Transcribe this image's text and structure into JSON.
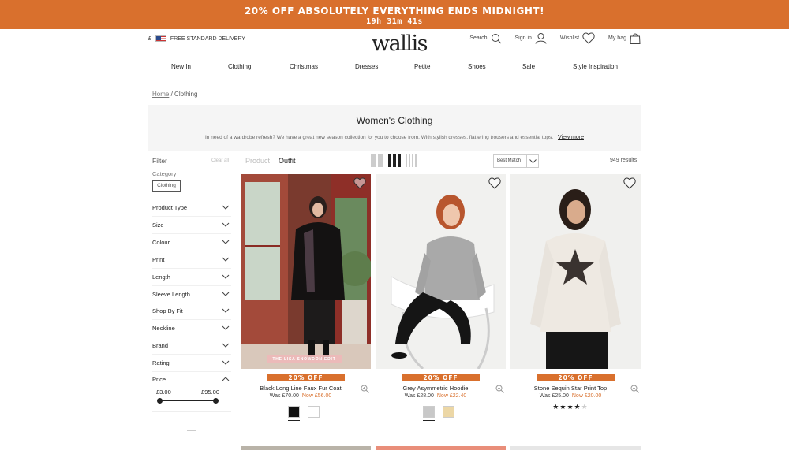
{
  "promo": {
    "headline": "20% OFF ABSOLUTELY EVERYTHING ENDS MIDNIGHT!",
    "countdown": "19h 31m 41s"
  },
  "header": {
    "currency": "£",
    "delivery": "FREE STANDARD DELIVERY",
    "logo": "wallis",
    "search": "Search",
    "signin": "Sign in",
    "wishlist": "Wishlist",
    "bag": "My bag"
  },
  "nav": [
    "New In",
    "Clothing",
    "Christmas",
    "Dresses",
    "Petite",
    "Shoes",
    "Sale",
    "Style Inspiration"
  ],
  "breadcrumb": {
    "home": "Home",
    "sep": "/",
    "current": "Clothing"
  },
  "hero": {
    "title": "Women's Clothing",
    "description": "In need of a wardrobe refresh? We have a great new season collection for you to choose from. With stylish dresses, flattering trousers and essential tops.",
    "view_more": "View more"
  },
  "filters": {
    "heading": "Filter",
    "clear_all": "Clear all",
    "category_label": "Category",
    "category_chip": "Clothing",
    "rows": [
      "Product Type",
      "Size",
      "Colour",
      "Print",
      "Length",
      "Sleeve Length",
      "Shop By Fit",
      "Neckline",
      "Brand",
      "Rating",
      "Price"
    ],
    "price_min": "£3.00",
    "price_max": "£95.00"
  },
  "toolbar": {
    "tab_product": "Product",
    "tab_outfit": "Outfit",
    "sort": "Best Match",
    "results": "949 results"
  },
  "products": [
    {
      "name": "Black Long Line Faux Fur Coat",
      "was": "Was £70.00",
      "now": "Now £56.00",
      "badge": "20% OFF",
      "tag": "THE LISA SNOWDON EDIT",
      "swatches": [
        "#111111",
        "#ffffff"
      ]
    },
    {
      "name": "Grey Asymmetric Hoodie",
      "was": "Was £28.00",
      "now": "Now £22.40",
      "badge": "20% OFF",
      "swatches": [
        "#c8c8c8",
        "#ecd7a6"
      ]
    },
    {
      "name": "Stone Sequin Star Print Top",
      "was": "Was £25.00",
      "now": "Now £20.00",
      "badge": "20% OFF",
      "rating": 4
    }
  ],
  "colors": {
    "accent": "#d9702d"
  }
}
